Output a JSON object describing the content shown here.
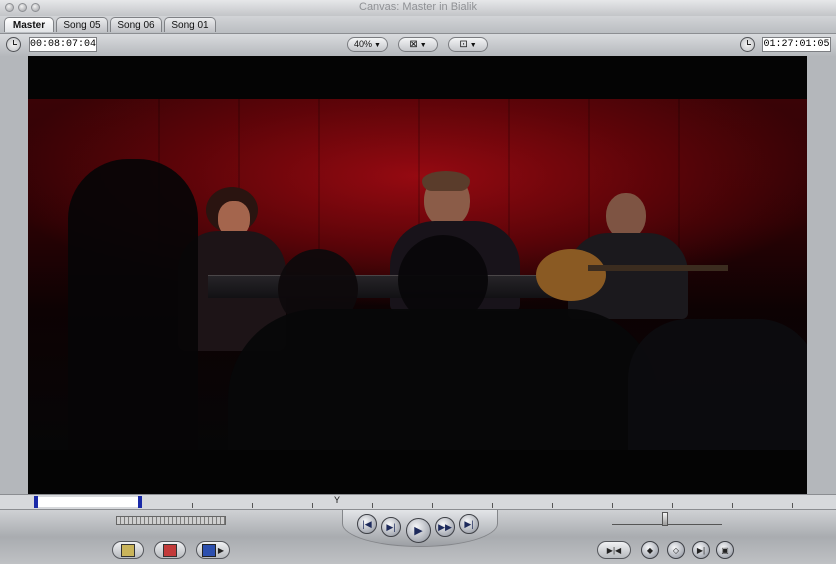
{
  "window": {
    "title": "Canvas: Master in Bialik"
  },
  "tabs": [
    {
      "label": "Master",
      "active": true
    },
    {
      "label": "Song 05",
      "active": false
    },
    {
      "label": "Song 06",
      "active": false
    },
    {
      "label": "Song 01",
      "active": false
    }
  ],
  "toolbar": {
    "duration_timecode": "00:08:07:04",
    "zoom_label": "40%",
    "view_menu_icon": "view-overlay-icon",
    "layout_menu_icon": "frame-overlay-icon",
    "current_timecode": "01:27:01:05"
  },
  "transport": {
    "buttons": [
      "go-to-previous-edit-icon",
      "play-in-to-out-icon",
      "play-icon",
      "play-around-current-icon",
      "go-to-next-edit-icon"
    ]
  },
  "edit_buttons": {
    "insert_icon": "insert-edit-icon",
    "overwrite_icon": "overwrite-edit-icon",
    "replace_icon": "replace-edit-icon"
  },
  "marker_buttons": [
    "mark-clip-icon",
    "add-keyframe-icon",
    "add-marker-icon",
    "mark-in-icon",
    "match-frame-icon"
  ],
  "colors": {
    "insert": "#c9b45a",
    "overwrite": "#c23a3a",
    "replace": "#2c4fae",
    "in_out_marker": "#1a2aa8"
  }
}
